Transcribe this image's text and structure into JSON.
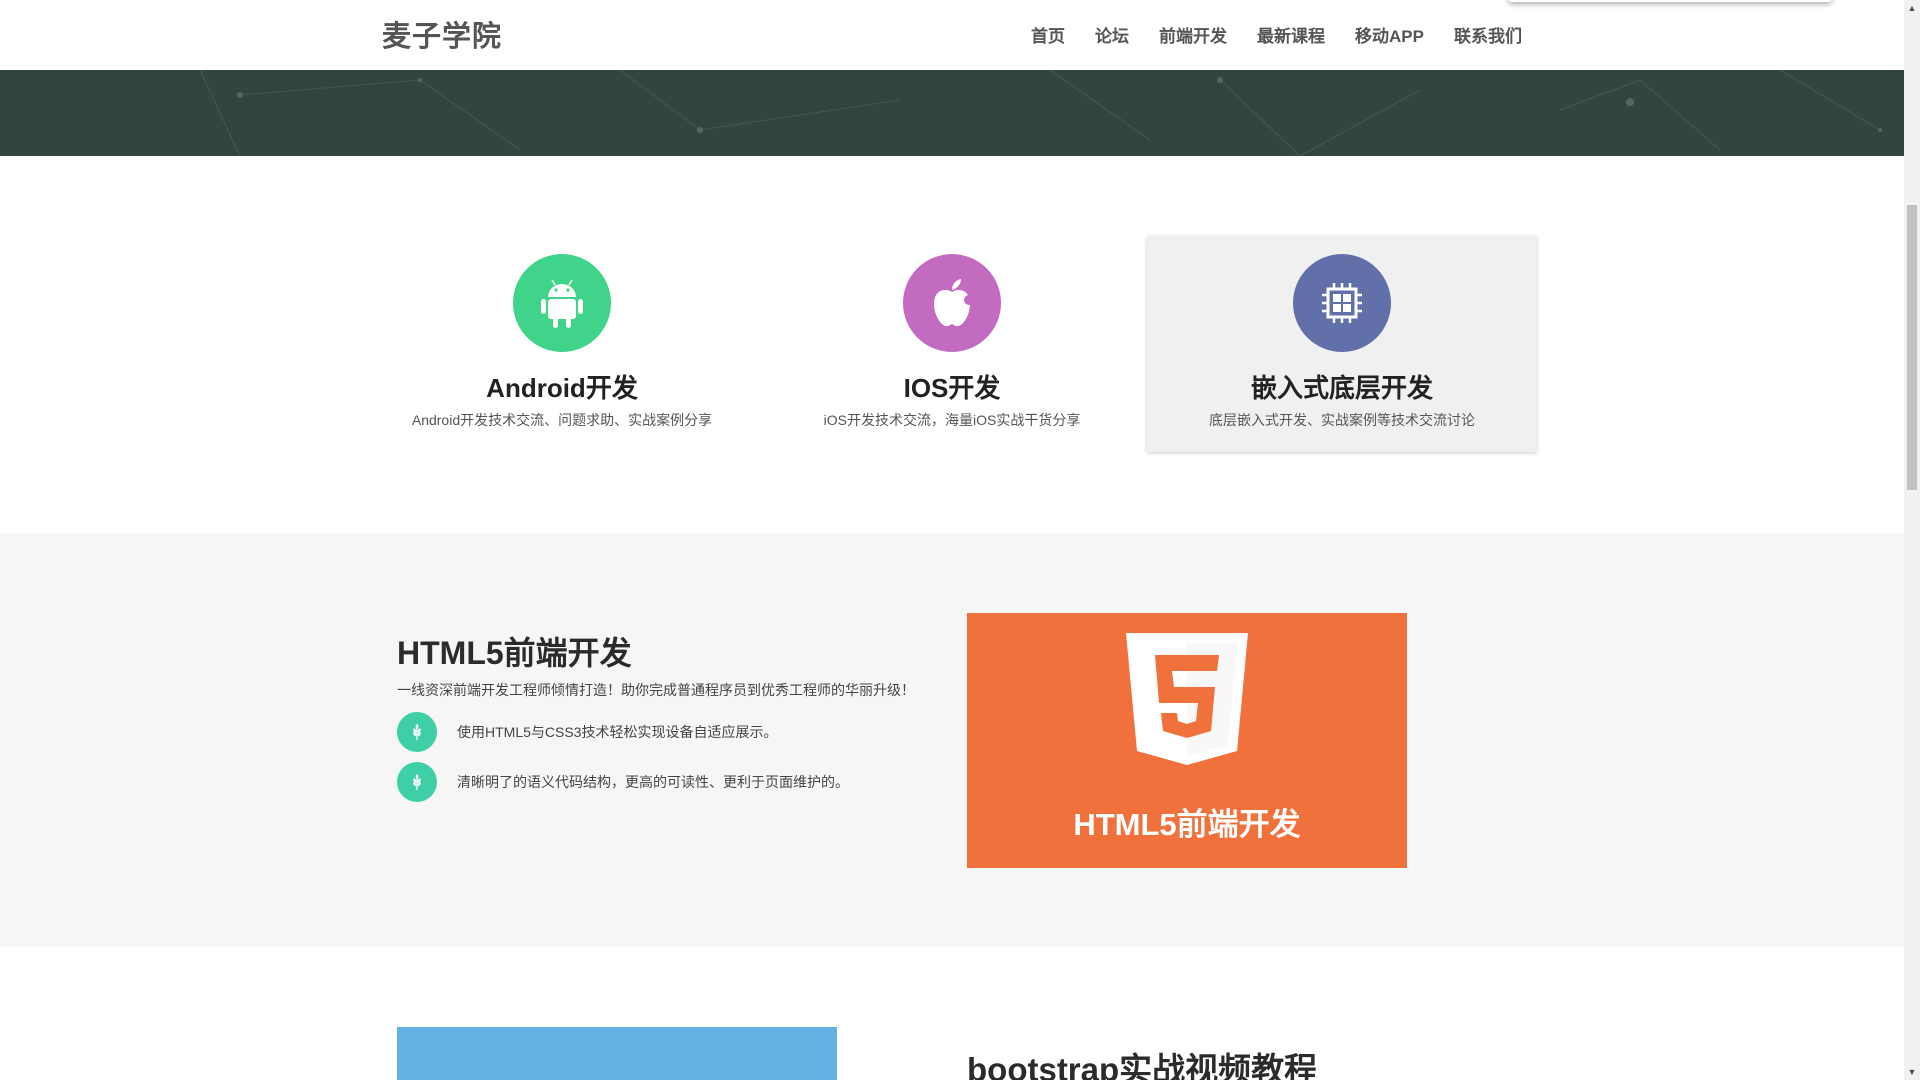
{
  "navbar": {
    "brand": "麦子学院",
    "items": [
      "首页",
      "论坛",
      "前端开发",
      "最新课程",
      "移动APP",
      "联系我们"
    ]
  },
  "features": [
    {
      "title": "Android开发",
      "desc": "Android开发技术交流、问题求助、实战案例分享",
      "icon": "android-icon",
      "color": "#3fd48a"
    },
    {
      "title": "IOS开发",
      "desc": "iOS开发技术交流，海量iOS实战干货分享",
      "icon": "apple-icon",
      "color": "#c36bc0"
    },
    {
      "title": "嵌入式底层开发",
      "desc": "底层嵌入式开发、实战案例等技术交流讨论",
      "icon": "chip-icon",
      "color": "#6170a8"
    }
  ],
  "html5": {
    "title": "HTML5前端开发",
    "lead": "一线资深前端开发工程师倾情打造！助你完成普通程序员到优秀工程师的华丽升级！",
    "bullets": [
      "使用HTML5与CSS3技术轻松实现设备自适应展示。",
      "清晰明了的语义代码结构，更高的可读性、更利于页面维护的。"
    ],
    "card_caption": "HTML5前端开发",
    "card_color": "#f0713c"
  },
  "bootstrap": {
    "title": "bootstrap实战视频教程"
  },
  "colors": {
    "hero": "#334540",
    "bullet": "#3fcfa6",
    "boot_image": "#64b0e3"
  }
}
